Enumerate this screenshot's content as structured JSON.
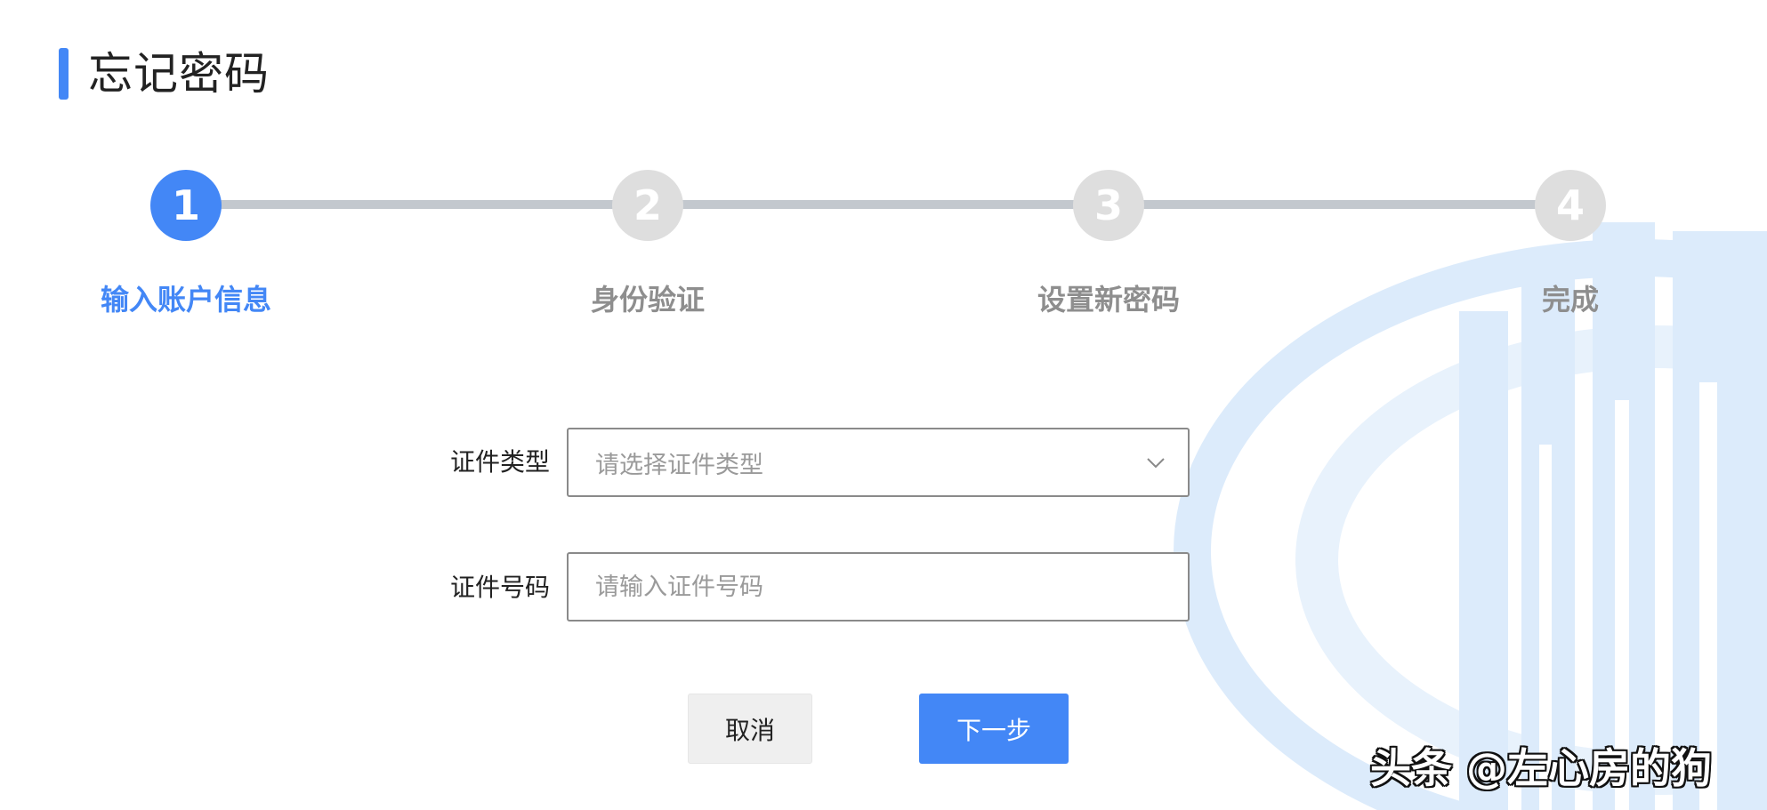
{
  "header": {
    "title": "忘记密码",
    "accent_color": "#4387f6"
  },
  "stepper": {
    "steps": [
      {
        "number": "1",
        "label": "输入账户信息",
        "active": true
      },
      {
        "number": "2",
        "label": "身份验证",
        "active": false
      },
      {
        "number": "3",
        "label": "设置新密码",
        "active": false
      },
      {
        "number": "4",
        "label": "完成",
        "active": false
      }
    ],
    "active_color": "#4387f6",
    "inactive_color": "#dedede"
  },
  "form": {
    "id_type": {
      "label": "证件类型",
      "placeholder": "请选择证件类型"
    },
    "id_number": {
      "label": "证件号码",
      "placeholder": "请输入证件号码",
      "value": ""
    }
  },
  "buttons": {
    "cancel_label": "取消",
    "next_label": "下一步"
  },
  "watermark": {
    "text": "头条 @左心房的狗"
  }
}
